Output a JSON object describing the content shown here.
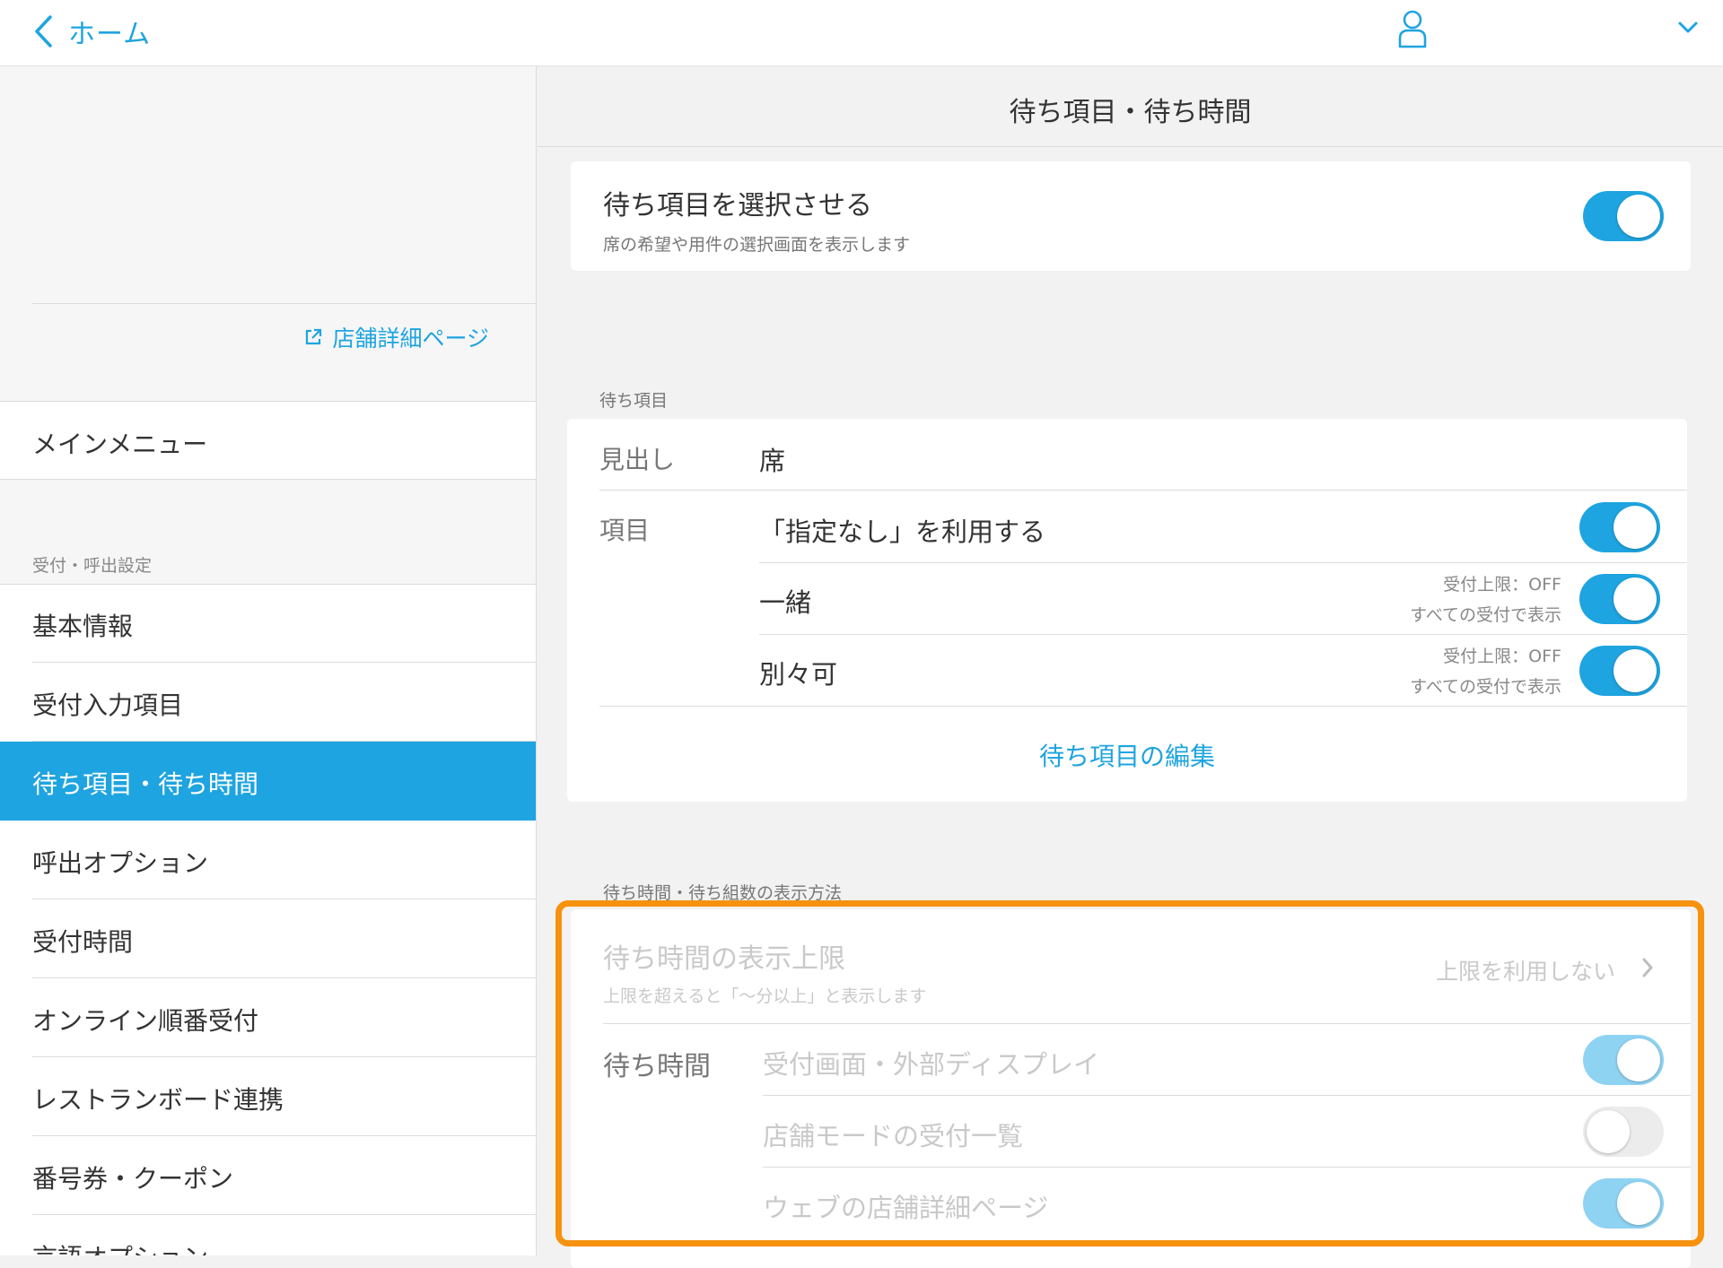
{
  "header": {
    "back_label": "ホーム"
  },
  "sidebar": {
    "store_link": "店舗詳細ページ",
    "main_menu": "メインメニュー",
    "section_header": "受付・呼出設定",
    "items": [
      {
        "label": "基本情報"
      },
      {
        "label": "受付入力項目"
      },
      {
        "label": "待ち項目・待ち時間"
      },
      {
        "label": "呼出オプション"
      },
      {
        "label": "受付時間"
      },
      {
        "label": "オンライン順番受付"
      },
      {
        "label": "レストランボード連携"
      },
      {
        "label": "番号券・クーポン"
      },
      {
        "label": "言語オプション"
      }
    ],
    "active_index": 2
  },
  "main": {
    "title": "待ち項目・待ち時間",
    "select_card": {
      "title": "待ち項目を選択させる",
      "description": "席の希望や用件の選択画面を表示します",
      "toggle": true
    },
    "wait_items": {
      "section_label": "待ち項目",
      "heading_label": "見出し",
      "heading_value": "席",
      "items_label": "項目",
      "none_option": {
        "label": "「指定なし」を利用する",
        "toggle": true
      },
      "items": [
        {
          "label": "一緒",
          "limit_note": "受付上限：OFF",
          "display_note": "すべての受付で表示",
          "toggle": true
        },
        {
          "label": "別々可",
          "limit_note": "受付上限：OFF",
          "display_note": "すべての受付で表示",
          "toggle": true
        }
      ],
      "edit_link": "待ち項目の編集"
    },
    "display_method": {
      "section_label": "待ち時間・待ち組数の表示方法",
      "limit_title": "待ち時間の表示上限",
      "limit_desc": "上限を超えると「〜分以上」と表示します",
      "limit_value": "上限を利用しない",
      "wait_time_label": "待ち時間",
      "rows": [
        {
          "label": "受付画面・外部ディスプレイ",
          "toggle": true
        },
        {
          "label": "店舗モードの受付一覧",
          "toggle": false
        },
        {
          "label": "ウェブの店舗詳細ページ",
          "toggle": true
        }
      ]
    }
  },
  "colors": {
    "accent": "#1ea4e0",
    "highlight": "#f7920f"
  }
}
